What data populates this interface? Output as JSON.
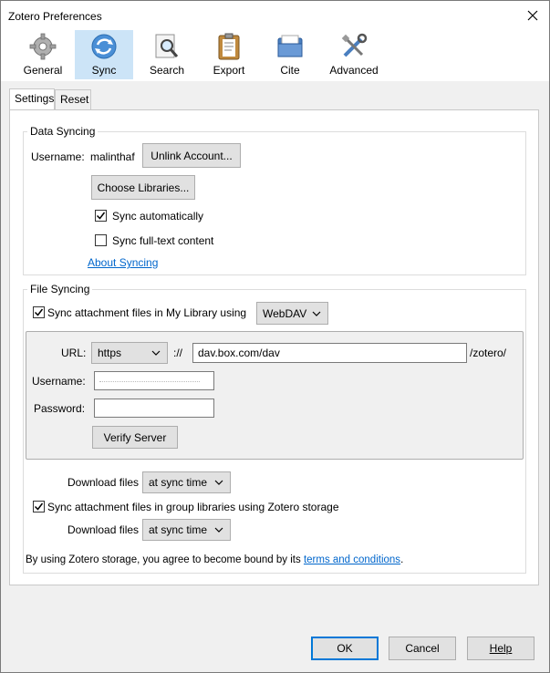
{
  "window": {
    "title": "Zotero Preferences"
  },
  "toolbar": {
    "items": [
      {
        "label": "General",
        "icon": "gear-icon"
      },
      {
        "label": "Sync",
        "icon": "sync-icon"
      },
      {
        "label": "Search",
        "icon": "magnifier-icon"
      },
      {
        "label": "Export",
        "icon": "clipboard-icon"
      },
      {
        "label": "Cite",
        "icon": "folder-icon"
      },
      {
        "label": "Advanced",
        "icon": "tools-icon"
      }
    ],
    "active": "Sync"
  },
  "tabs": [
    {
      "label": "Settings"
    },
    {
      "label": "Reset"
    }
  ],
  "data_syncing": {
    "legend": "Data Syncing",
    "username_label": "Username:",
    "username_value": "malinthaf",
    "unlink_button": "Unlink Account...",
    "choose_libraries_button": "Choose Libraries...",
    "sync_auto_label": "Sync automatically",
    "sync_auto_checked": true,
    "sync_fulltext_label": "Sync full-text content",
    "sync_fulltext_checked": false,
    "about_link": "About Syncing"
  },
  "file_syncing": {
    "legend": "File Syncing",
    "sync_my_library_label": "Sync attachment files in My Library using",
    "sync_my_library_checked": true,
    "method_value": "WebDAV",
    "url_label": "URL:",
    "protocol_value": "https",
    "scheme_sep": "://",
    "url_value": "dav.box.com/dav",
    "url_suffix": "/zotero/",
    "username_label": "Username:",
    "password_label": "Password:",
    "verify_button": "Verify Server",
    "download_files_label": "Download files",
    "download_files_value": "at sync time",
    "sync_group_label": "Sync attachment files in group libraries using Zotero storage",
    "sync_group_checked": true,
    "download_files_label_2": "Download files",
    "download_files_value_2": "at sync time",
    "terms_prefix": "By using Zotero storage, you agree to become bound by its ",
    "terms_link": "terms and conditions",
    "terms_suffix": "."
  },
  "footer": {
    "ok": "OK",
    "cancel": "Cancel",
    "help": "Help"
  },
  "colors": {
    "active_tab": "#cce4f7",
    "link": "#0066cc",
    "primary_border": "#0078d7"
  }
}
